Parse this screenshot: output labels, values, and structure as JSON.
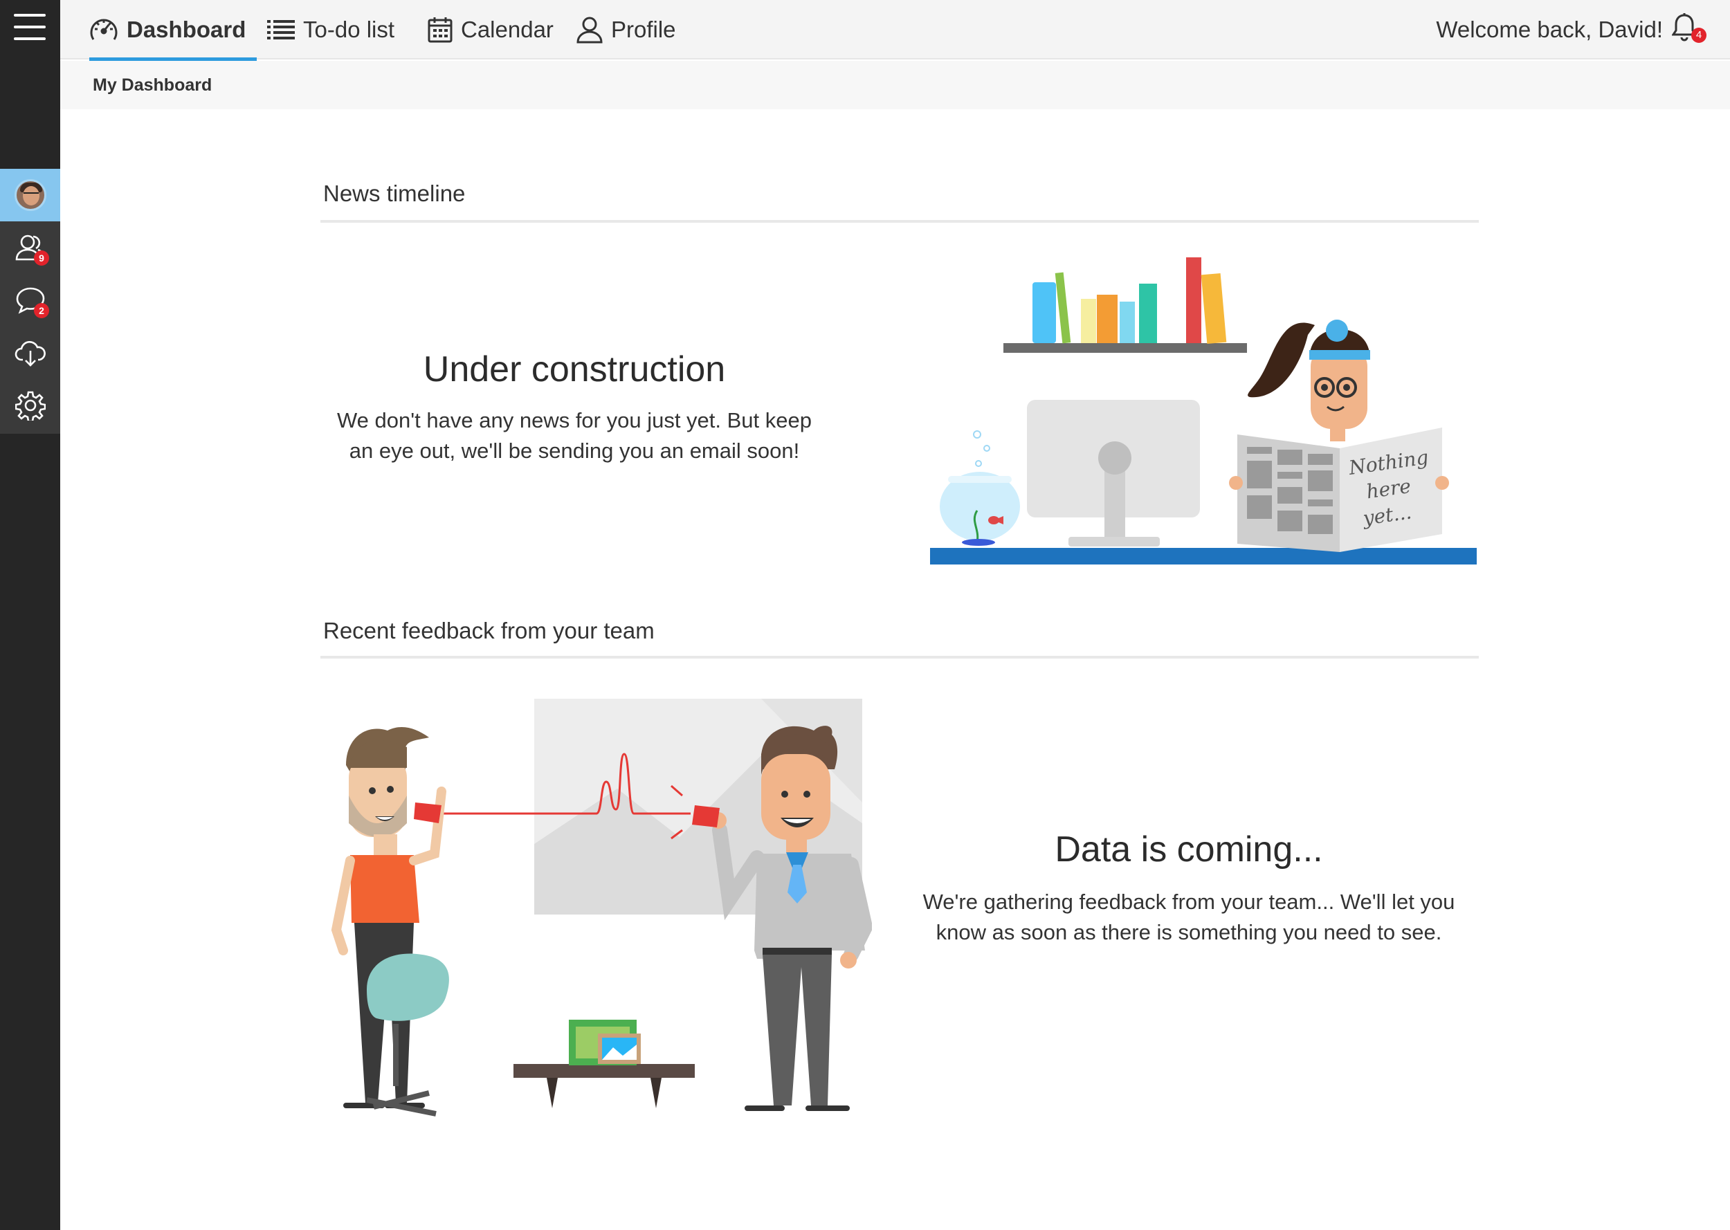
{
  "nav": {
    "tabs": [
      {
        "label": "Dashboard",
        "icon": "speedometer-icon",
        "active": true
      },
      {
        "label": "To-do list",
        "icon": "list-icon"
      },
      {
        "label": "Calendar",
        "icon": "calendar-icon"
      },
      {
        "label": "Profile",
        "icon": "user-icon"
      }
    ],
    "welcome": "Welcome back, David!",
    "notification_count": "4"
  },
  "breadcrumb": "My Dashboard",
  "sidebar": {
    "items": [
      {
        "icon": "avatar",
        "badge": ""
      },
      {
        "icon": "team-icon",
        "badge": "9"
      },
      {
        "icon": "chat-icon",
        "badge": "2"
      },
      {
        "icon": "cloud-download-icon",
        "badge": ""
      },
      {
        "icon": "gear-icon",
        "badge": ""
      }
    ]
  },
  "news": {
    "section_title": "News timeline",
    "heading": "Under construction",
    "line1": "We don't have any news for you just yet. But keep",
    "line2": "an eye out, we'll be sending you an email soon!",
    "newspaper_line1": "Nothing",
    "newspaper_line2": "here",
    "newspaper_line3": "yet..."
  },
  "feedback": {
    "section_title": "Recent feedback from your team",
    "heading": "Data is coming...",
    "line1": "We're gathering feedback from your team... We'll let you",
    "line2": "know as soon as there is something you need to see."
  },
  "colors": {
    "accent": "#2d9bde",
    "rail": "#262626",
    "badge": "#e2232b",
    "desk": "#1e73be"
  }
}
